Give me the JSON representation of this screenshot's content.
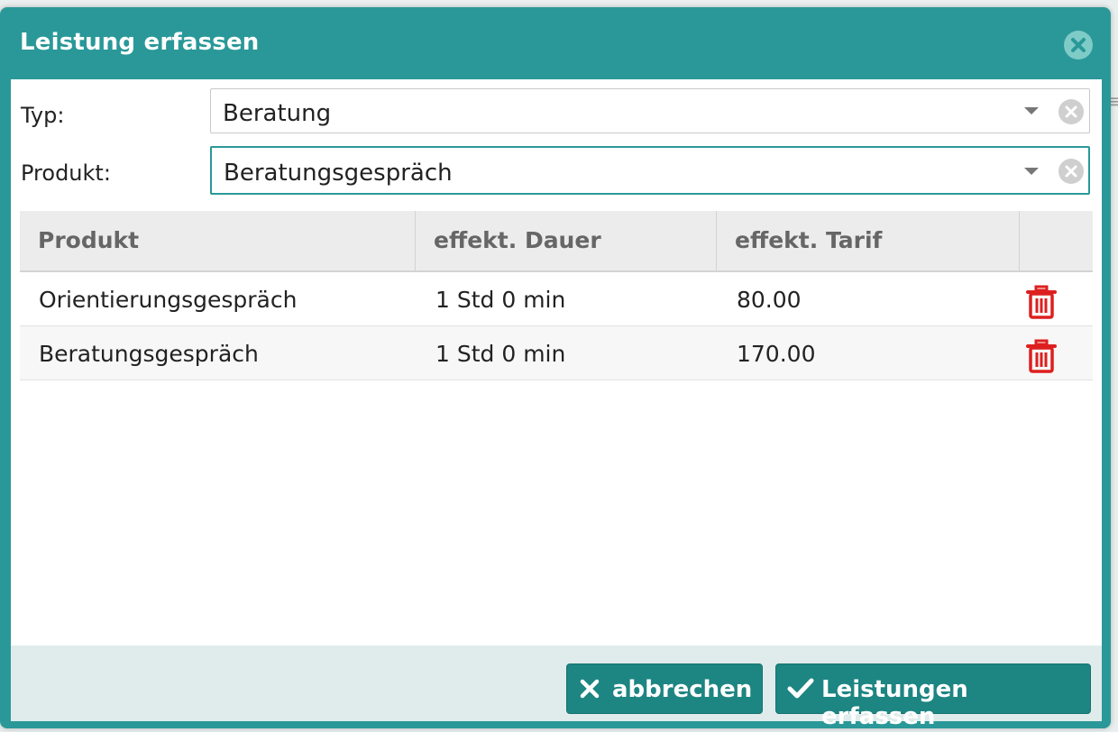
{
  "dialog": {
    "title": "Leistung erfassen",
    "close_icon": "close-circle-icon"
  },
  "form": {
    "typ": {
      "label": "Typ:",
      "value": "Beratung"
    },
    "produkt": {
      "label": "Produkt:",
      "value": "Beratungsgespräch"
    }
  },
  "table": {
    "headers": [
      "Produkt",
      "effekt. Dauer",
      "effekt. Tarif",
      ""
    ],
    "rows": [
      {
        "produkt": "Orientierungsgespräch",
        "dauer": "1 Std 0 min",
        "tarif": "80.00",
        "action_icon": "trash-icon"
      },
      {
        "produkt": "Beratungsgespräch",
        "dauer": "1 Std 0 min",
        "tarif": "170.00",
        "action_icon": "trash-icon"
      }
    ]
  },
  "footer": {
    "cancel_label": "abbrechen",
    "cancel_icon": "x-icon",
    "submit_label": "Leistungen erfassen",
    "submit_icon": "check-icon"
  },
  "colors": {
    "accent": "#2a9898",
    "button": "#1d8582",
    "danger": "#dd1f1f",
    "footer_bg": "#e0ecec"
  }
}
